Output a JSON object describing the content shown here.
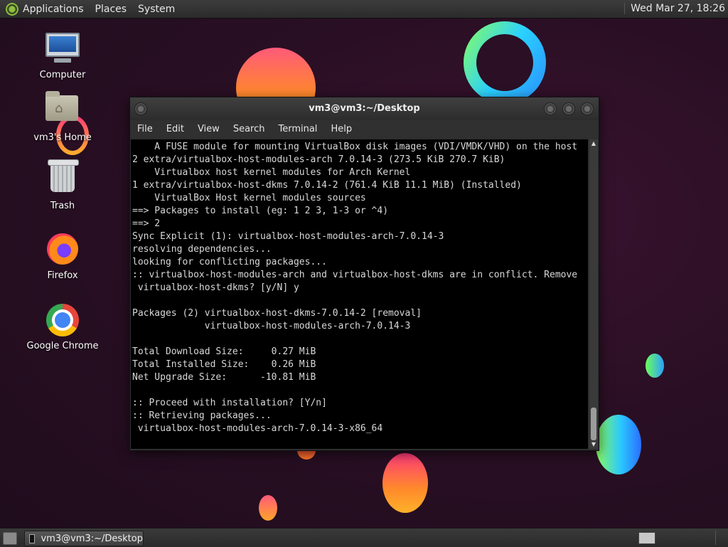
{
  "top_panel": {
    "menus": [
      "Applications",
      "Places",
      "System"
    ],
    "clock": "Wed Mar 27, 18:26"
  },
  "desktop_icons": [
    {
      "label": "Computer",
      "icon": "computer-icon"
    },
    {
      "label": "vm3's Home",
      "icon": "home-folder-icon"
    },
    {
      "label": "Trash",
      "icon": "trash-icon"
    },
    {
      "label": "Firefox",
      "icon": "firefox-icon"
    },
    {
      "label": "Google Chrome",
      "icon": "chrome-icon"
    }
  ],
  "terminal": {
    "title": "vm3@vm3:~/Desktop",
    "menu": [
      "File",
      "Edit",
      "View",
      "Search",
      "Terminal",
      "Help"
    ],
    "lines": [
      "    A FUSE module for mounting VirtualBox disk images (VDI/VMDK/VHD) on the host",
      "2 extra/virtualbox-host-modules-arch 7.0.14-3 (273.5 KiB 270.7 KiB)",
      "    Virtualbox host kernel modules for Arch Kernel",
      "1 extra/virtualbox-host-dkms 7.0.14-2 (761.4 KiB 11.1 MiB) (Installed)",
      "    VirtualBox Host kernel modules sources",
      "==> Packages to install (eg: 1 2 3, 1-3 or ^4)",
      "==> 2",
      "Sync Explicit (1): virtualbox-host-modules-arch-7.0.14-3",
      "resolving dependencies...",
      "looking for conflicting packages...",
      ":: virtualbox-host-modules-arch and virtualbox-host-dkms are in conflict. Remove",
      " virtualbox-host-dkms? [y/N] y",
      "",
      "Packages (2) virtualbox-host-dkms-7.0.14-2 [removal]",
      "             virtualbox-host-modules-arch-7.0.14-3",
      "",
      "Total Download Size:     0.27 MiB",
      "Total Installed Size:    0.26 MiB",
      "Net Upgrade Size:      -10.81 MiB",
      "",
      ":: Proceed with installation? [Y/n]",
      ":: Retrieving packages...",
      " virtualbox-host-modules-arch-7.0.14-3-x86_64"
    ]
  },
  "bottom_panel": {
    "task_label": "vm3@vm3:~/Desktop"
  }
}
